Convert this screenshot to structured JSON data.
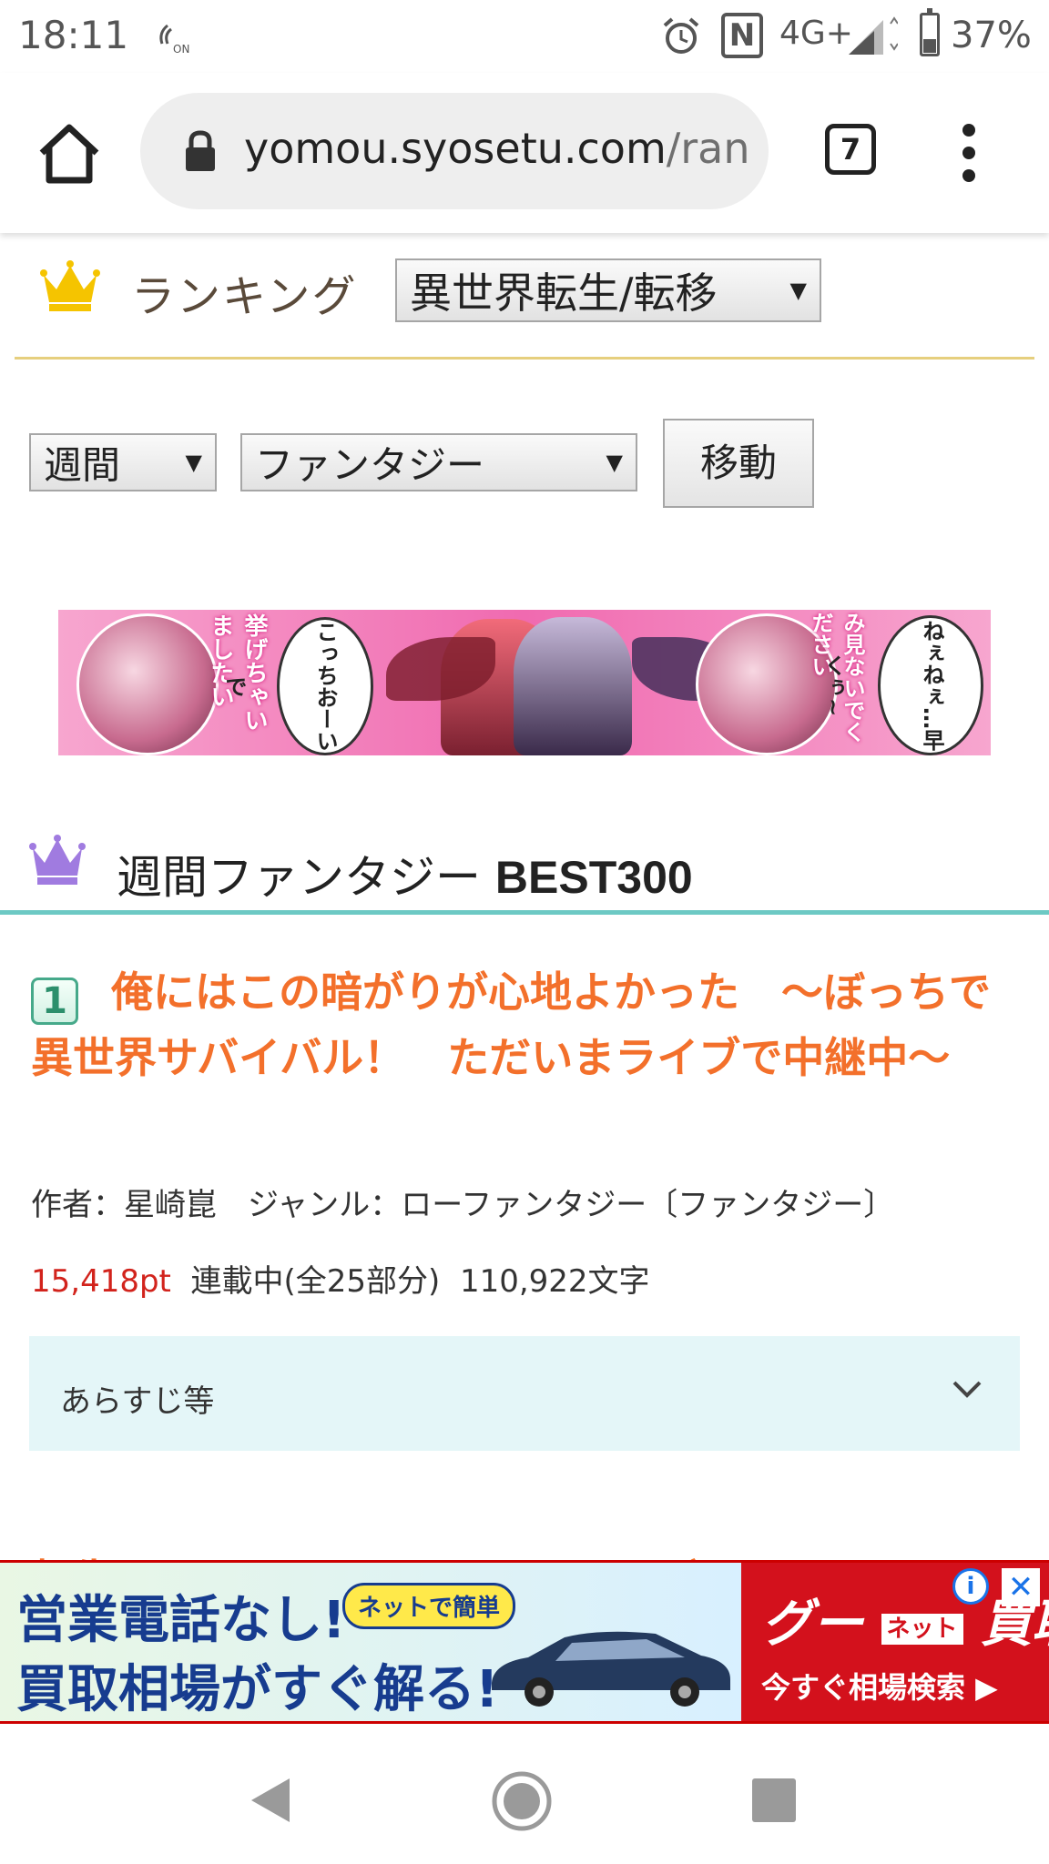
{
  "status_bar": {
    "time": "18:11",
    "network": "4G+",
    "nfc_letter": "N",
    "battery": "37%"
  },
  "browser": {
    "url_host": "yomou.syosetu.com",
    "url_path": "/ran",
    "tab_count": "7"
  },
  "header": {
    "title": "ランキング",
    "genre_select": "異世界転生/転移"
  },
  "filters": {
    "period": "週間",
    "category": "ファンタジー",
    "move_button": "移動"
  },
  "banner_ad": {
    "bubble1": "こっちおーいで",
    "bubble2": "ねぇねぇ…早くぅ~",
    "side_text1": "挙げちゃいましたい",
    "side_text2": "み見ないでください"
  },
  "section": {
    "title_prefix": "週間ファンタジー ",
    "title_suffix": "BEST300"
  },
  "ranking": [
    {
      "rank": "1",
      "title": "俺にはこの暗がりが心地よかった　～ぼっちで異世界サバイバル！　ただいまライブで中継中～",
      "meta": "作者：星崎崑　ジャンル：ローファンタジー〔ファンタジー〕",
      "points": "15,418pt",
      "status": "連載中(全25部分)",
      "chars": "110,922文字",
      "synopsis_label": "あらすじ等"
    }
  ],
  "next_peek": "転生してハイエルフになりましたが、スロ",
  "bottom_ad": {
    "line1": "営業電話なし!",
    "line2": "買取相場がすぐ解る!",
    "tag": "ネットで簡単",
    "brand": "グー",
    "brand_net": "ネット",
    "brand_suffix": "買取",
    "cta": "今すぐ相場検索 ▶",
    "info": "i",
    "close": "✕"
  }
}
